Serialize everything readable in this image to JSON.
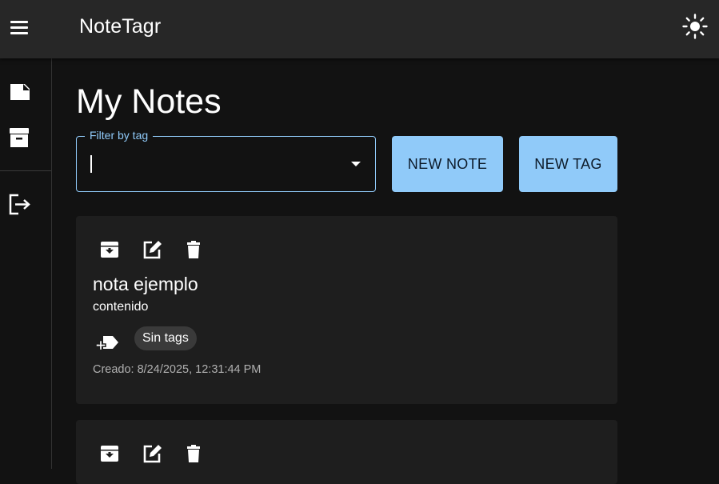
{
  "app": {
    "title": "NoteTagr",
    "menu_icon": "menu-icon",
    "theme_icon": "sun-icon"
  },
  "sidebar": {
    "items": [
      {
        "name": "notes",
        "icon": "note-icon"
      },
      {
        "name": "archive",
        "icon": "archive-box-icon"
      },
      {
        "name": "logout",
        "icon": "logout-icon"
      }
    ]
  },
  "page": {
    "title": "My Notes"
  },
  "filter": {
    "label": "Filter by tag",
    "value": ""
  },
  "buttons": {
    "new_note": "NEW NOTE",
    "new_tag": "NEW TAG"
  },
  "notes": [
    {
      "title": "nota ejemplo",
      "content": "contenido",
      "tags_empty_label": "Sin tags",
      "created_label": "Creado:",
      "created_value": "8/24/2025, 12:31:44 PM",
      "actions": [
        "archive-icon",
        "edit-icon",
        "delete-icon"
      ]
    },
    {
      "actions": [
        "archive-icon",
        "edit-icon",
        "delete-icon"
      ]
    }
  ],
  "colors": {
    "accent": "#90caf9",
    "background": "#121212",
    "surface": "#1e1e1e",
    "appbar": "#272727"
  }
}
